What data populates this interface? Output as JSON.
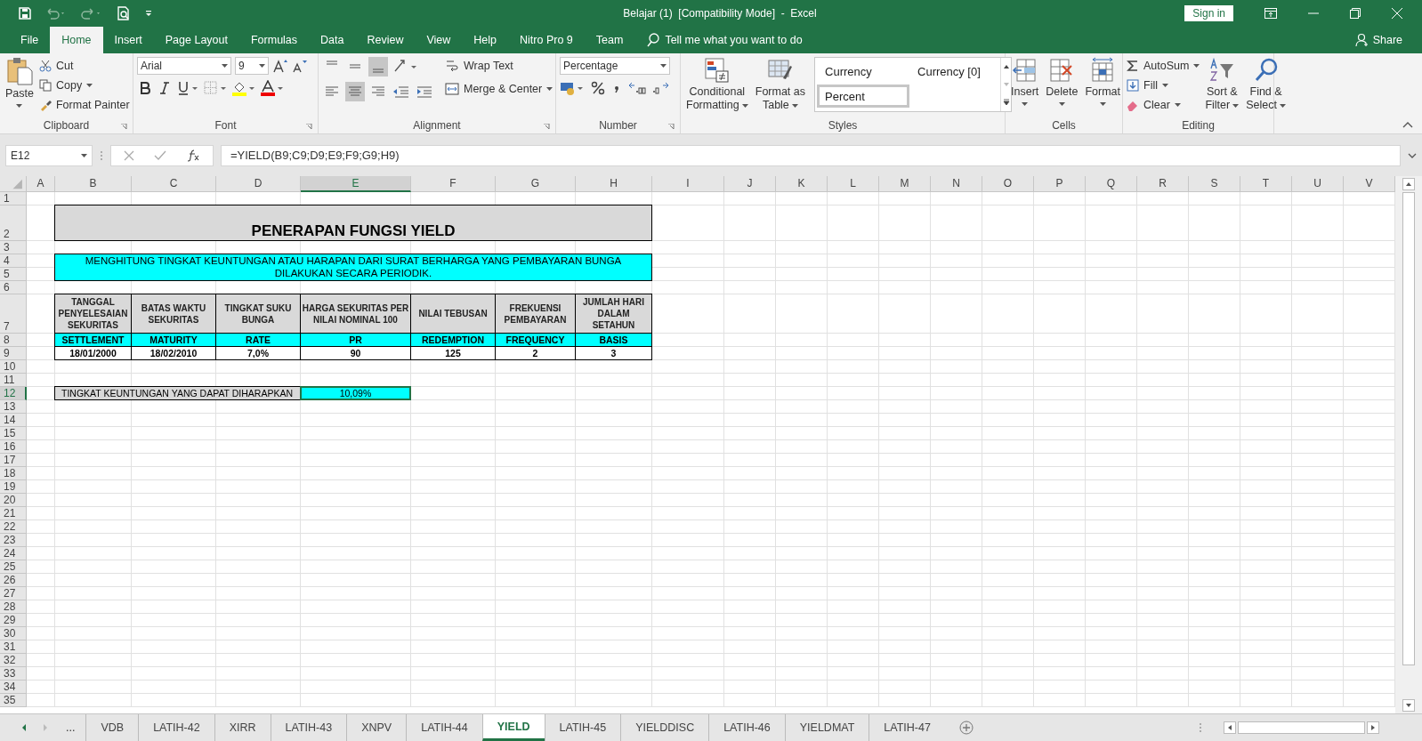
{
  "title_bar": {
    "title": "Belajar (1)  [Compatibility Mode]  -  Excel",
    "sign_in": "Sign in"
  },
  "ribbon_tabs": [
    {
      "label": "File",
      "selected": false
    },
    {
      "label": "Home",
      "selected": true
    },
    {
      "label": "Insert",
      "selected": false
    },
    {
      "label": "Page Layout",
      "selected": false
    },
    {
      "label": "Formulas",
      "selected": false
    },
    {
      "label": "Data",
      "selected": false
    },
    {
      "label": "Review",
      "selected": false
    },
    {
      "label": "View",
      "selected": false
    },
    {
      "label": "Help",
      "selected": false
    },
    {
      "label": "Nitro Pro 9",
      "selected": false
    },
    {
      "label": "Team",
      "selected": false
    }
  ],
  "tell_me": "Tell me what you want to do",
  "share": "Share",
  "clipboard": {
    "paste": "Paste",
    "cut": "Cut",
    "copy": "Copy",
    "format_painter": "Format Painter",
    "label": "Clipboard"
  },
  "font": {
    "name": "Arial",
    "size": "9",
    "label": "Font"
  },
  "alignment": {
    "vertical": [
      {
        "kind": "top",
        "selected": false
      },
      {
        "kind": "middle",
        "selected": false
      },
      {
        "kind": "bottom",
        "selected": true
      }
    ],
    "horizontal": [
      {
        "kind": "left",
        "selected": false
      },
      {
        "kind": "center",
        "selected": true
      },
      {
        "kind": "right",
        "selected": false
      }
    ],
    "wrap_text": "Wrap Text",
    "merge_center": "Merge & Center",
    "label": "Alignment"
  },
  "number": {
    "format": "Percentage",
    "label": "Number"
  },
  "styles": {
    "conditional": [
      "Conditional",
      "Formatting"
    ],
    "format_table": [
      "Format as",
      "Table"
    ],
    "cell_styles": [
      {
        "label": "Currency",
        "selected": false
      },
      {
        "label": "Currency [0]",
        "selected": false
      },
      {
        "label": "Percent",
        "selected": true
      }
    ],
    "label": "Styles"
  },
  "cells": {
    "buttons": [
      {
        "kind": "insert",
        "label": "Insert"
      },
      {
        "kind": "delete",
        "label": "Delete"
      },
      {
        "kind": "format",
        "label": "Format"
      }
    ],
    "label": "Cells"
  },
  "editing": {
    "autosum": "AutoSum",
    "fill": "Fill",
    "clear": "Clear",
    "sort": [
      "Sort &",
      "Filter"
    ],
    "find": [
      "Find &",
      "Select"
    ],
    "label": "Editing"
  },
  "name_box": "E12",
  "formula": "=YIELD(B9;C9;D9;E9;F9;G9;H9)",
  "columns": [
    {
      "label": "A",
      "selected": false
    },
    {
      "label": "B",
      "selected": false
    },
    {
      "label": "C",
      "selected": false
    },
    {
      "label": "D",
      "selected": false
    },
    {
      "label": "E",
      "selected": true
    },
    {
      "label": "F",
      "selected": false
    },
    {
      "label": "G",
      "selected": false
    },
    {
      "label": "H",
      "selected": false
    },
    {
      "label": "I",
      "selected": false
    },
    {
      "label": "J",
      "selected": false
    },
    {
      "label": "K",
      "selected": false
    },
    {
      "label": "L",
      "selected": false
    },
    {
      "label": "M",
      "selected": false
    },
    {
      "label": "N",
      "selected": false
    },
    {
      "label": "O",
      "selected": false
    },
    {
      "label": "P",
      "selected": false
    },
    {
      "label": "Q",
      "selected": false
    },
    {
      "label": "R",
      "selected": false
    },
    {
      "label": "S",
      "selected": false
    },
    {
      "label": "T",
      "selected": false
    },
    {
      "label": "U",
      "selected": false
    },
    {
      "label": "V",
      "selected": false
    }
  ],
  "rows": [
    {
      "label": "1",
      "selected": false
    },
    {
      "label": "2",
      "selected": false
    },
    {
      "label": "3",
      "selected": false
    },
    {
      "label": "4",
      "selected": false
    },
    {
      "label": "5",
      "selected": false
    },
    {
      "label": "6",
      "selected": false
    },
    {
      "label": "7",
      "selected": false
    },
    {
      "label": "8",
      "selected": false
    },
    {
      "label": "9",
      "selected": false
    },
    {
      "label": "10",
      "selected": false
    },
    {
      "label": "11",
      "selected": false
    },
    {
      "label": "12",
      "selected": true
    },
    {
      "label": "13",
      "selected": false
    },
    {
      "label": "14",
      "selected": false
    },
    {
      "label": "15",
      "selected": false
    },
    {
      "label": "16",
      "selected": false
    },
    {
      "label": "17",
      "selected": false
    },
    {
      "label": "18",
      "selected": false
    },
    {
      "label": "19",
      "selected": false
    },
    {
      "label": "20",
      "selected": false
    },
    {
      "label": "21",
      "selected": false
    },
    {
      "label": "22",
      "selected": false
    },
    {
      "label": "23",
      "selected": false
    },
    {
      "label": "24",
      "selected": false
    },
    {
      "label": "25",
      "selected": false
    },
    {
      "label": "26",
      "selected": false
    },
    {
      "label": "27",
      "selected": false
    },
    {
      "label": "28",
      "selected": false
    },
    {
      "label": "29",
      "selected": false
    },
    {
      "label": "30",
      "selected": false
    },
    {
      "label": "31",
      "selected": false
    },
    {
      "label": "32",
      "selected": false
    },
    {
      "label": "33",
      "selected": false
    },
    {
      "label": "34",
      "selected": false
    },
    {
      "label": "35",
      "selected": false
    }
  ],
  "sheet": {
    "title": "PENERAPAN FUNGSI YIELD",
    "subtitle": "MENGHITUNG TINGKAT KEUNTUNGAN ATAU HARAPAN DARI SURAT BERHARGA YANG PEMBAYARAN BUNGA DILAKUKAN SECARA PERIODIK.",
    "table": [
      {
        "header": "TANGGAL PENYELESAIAN SEKURITAS",
        "code": "SETTLEMENT",
        "value": "18/01/2000"
      },
      {
        "header": "BATAS WAKTU SEKURITAS",
        "code": "MATURITY",
        "value": "18/02/2010"
      },
      {
        "header": "TINGKAT SUKU BUNGA",
        "code": "RATE",
        "value": "7,0%"
      },
      {
        "header": "HARGA SEKURITAS PER NILAI NOMINAL 100",
        "code": "PR",
        "value": "90"
      },
      {
        "header": "NILAI TEBUSAN",
        "code": "REDEMPTION",
        "value": "125"
      },
      {
        "header": "FREKUENSI PEMBAYARAN",
        "code": "FREQUENCY",
        "value": "2"
      },
      {
        "header": "JUMLAH HARI DALAM SETAHUN",
        "code": "BASIS",
        "value": "3"
      }
    ],
    "result_label": "TINGKAT KEUNTUNGAN YANG DAPAT DIHARAPKAN",
    "result_value": "10,09%",
    "result_selected": true
  },
  "more_sheets": "...",
  "sheet_tabs": [
    {
      "label": "VDB",
      "selected": false
    },
    {
      "label": "LATIH-42",
      "selected": false
    },
    {
      "label": "XIRR",
      "selected": false
    },
    {
      "label": "LATIH-43",
      "selected": false
    },
    {
      "label": "XNPV",
      "selected": false
    },
    {
      "label": "LATIH-44",
      "selected": false
    },
    {
      "label": "YIELD",
      "selected": true
    },
    {
      "label": "LATIH-45",
      "selected": false
    },
    {
      "label": "YIELDDISC",
      "selected": false
    },
    {
      "label": "LATIH-46",
      "selected": false
    },
    {
      "label": "YIELDMAT",
      "selected": false
    },
    {
      "label": "LATIH-47",
      "selected": false
    }
  ]
}
